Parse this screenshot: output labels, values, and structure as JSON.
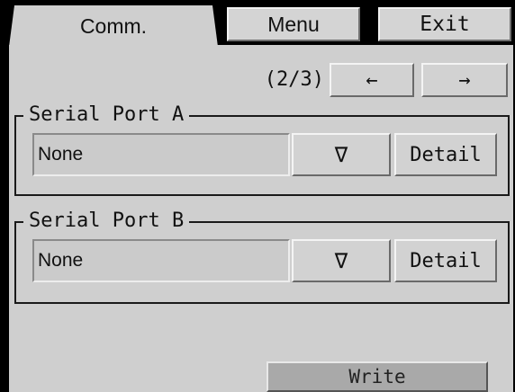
{
  "tabs": {
    "comm_label": "Comm.",
    "menu_label": "Menu",
    "exit_label": "Exit"
  },
  "pager": {
    "indicator": "(2/3)",
    "prev_label": "←",
    "next_label": "→"
  },
  "serial_port_a": {
    "title": "Serial Port A",
    "value": "None",
    "dropdown_label": "∇",
    "detail_label": "Detail"
  },
  "serial_port_b": {
    "title": "Serial Port B",
    "value": "None",
    "dropdown_label": "∇",
    "detail_label": "Detail"
  },
  "write_label": "Write",
  "colors": {
    "background": "#cfcfcf",
    "frame": "#000000",
    "write_button": "#a9a9a9"
  }
}
